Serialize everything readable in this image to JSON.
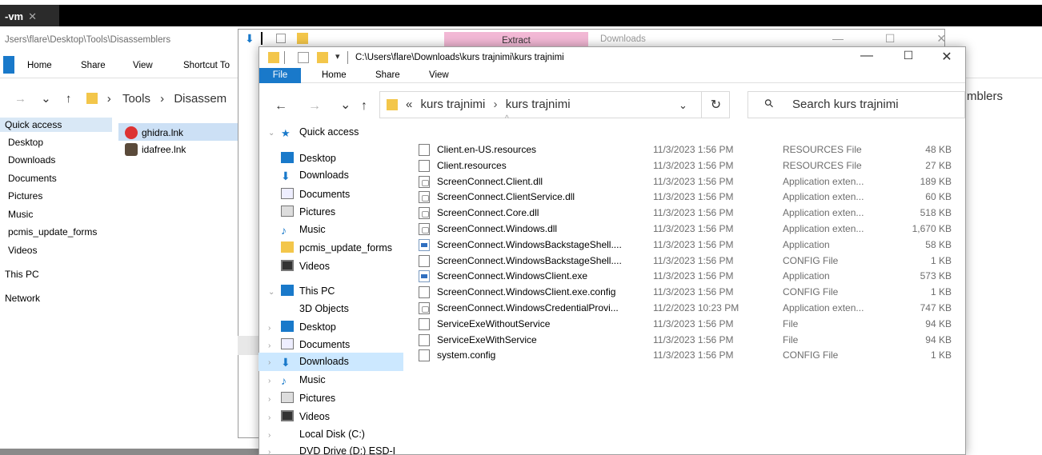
{
  "vm_tab": {
    "label": "-vm",
    "close": "✕"
  },
  "back_window": {
    "path": "Jsers\\flare\\Desktop\\Tools\\Disassemblers",
    "tabs": [
      "Home",
      "Share",
      "View",
      "Shortcut To"
    ],
    "breadcrumb": [
      "Tools",
      "Disassem"
    ],
    "right_crumb": "mblers",
    "sidebar": [
      "Quick access",
      "Desktop",
      "Downloads",
      "Documents",
      "Pictures",
      "Music",
      "pcmis_update_forms",
      "Videos",
      "This PC",
      "Network"
    ],
    "files": [
      "ghidra.lnk",
      "idafree.lnk"
    ]
  },
  "mid_window": {
    "tab_label": "Extract",
    "title": "Downloads"
  },
  "window": {
    "title": "C:\\Users\\flare\\Downloads\\kurs trajnimi\\kurs trajnimi",
    "controls": {
      "minimize": "—",
      "maximize": "☐",
      "close": "✕"
    },
    "ribbon_tabs": {
      "file": "File",
      "home": "Home",
      "share": "Share",
      "view": "View"
    }
  },
  "nav": {
    "back": "←",
    "forward": "→",
    "recent": "⌄",
    "up": "↑",
    "address_prefix": "«",
    "address": [
      "kurs trajnimi",
      "kurs trajnimi"
    ],
    "refresh": "↻",
    "search_placeholder": "Search kurs trajnimi"
  },
  "nav_pane": {
    "quick_access": "Quick access",
    "items": [
      {
        "label": "Desktop",
        "icon": "desktop-icon"
      },
      {
        "label": "Downloads",
        "icon": "downloads-icon"
      },
      {
        "label": "Documents",
        "icon": "documents-icon"
      },
      {
        "label": "Pictures",
        "icon": "pictures-icon"
      },
      {
        "label": "Music",
        "icon": "music-icon"
      },
      {
        "label": "pcmis_update_forms",
        "icon": "folder-icon"
      },
      {
        "label": "Videos",
        "icon": "videos-icon"
      }
    ],
    "this_pc": "This PC",
    "pc_items": [
      {
        "label": "3D Objects",
        "icon": "3d-objects-icon"
      },
      {
        "label": "Desktop",
        "icon": "desktop-icon"
      },
      {
        "label": "Documents",
        "icon": "documents-icon"
      },
      {
        "label": "Downloads",
        "icon": "downloads-icon",
        "selected": true
      },
      {
        "label": "Music",
        "icon": "music-icon"
      },
      {
        "label": "Pictures",
        "icon": "pictures-icon"
      },
      {
        "label": "Videos",
        "icon": "videos-icon"
      },
      {
        "label": "Local Disk (C:)",
        "icon": "disk-icon"
      },
      {
        "label": "DVD Drive (D:) ESD-I",
        "icon": "dvd-icon"
      }
    ]
  },
  "files": [
    {
      "name": "Client.en-US.resources",
      "date": "11/3/2023 1:56 PM",
      "type": "RESOURCES File",
      "size": "48 KB",
      "kind": "file"
    },
    {
      "name": "Client.resources",
      "date": "11/3/2023 1:56 PM",
      "type": "RESOURCES File",
      "size": "27 KB",
      "kind": "file"
    },
    {
      "name": "ScreenConnect.Client.dll",
      "date": "11/3/2023 1:56 PM",
      "type": "Application exten...",
      "size": "189 KB",
      "kind": "dll"
    },
    {
      "name": "ScreenConnect.ClientService.dll",
      "date": "11/3/2023 1:56 PM",
      "type": "Application exten...",
      "size": "60 KB",
      "kind": "dll"
    },
    {
      "name": "ScreenConnect.Core.dll",
      "date": "11/3/2023 1:56 PM",
      "type": "Application exten...",
      "size": "518 KB",
      "kind": "dll"
    },
    {
      "name": "ScreenConnect.Windows.dll",
      "date": "11/3/2023 1:56 PM",
      "type": "Application exten...",
      "size": "1,670 KB",
      "kind": "dll"
    },
    {
      "name": "ScreenConnect.WindowsBackstageShell....",
      "date": "11/3/2023 1:56 PM",
      "type": "Application",
      "size": "58 KB",
      "kind": "exe"
    },
    {
      "name": "ScreenConnect.WindowsBackstageShell....",
      "date": "11/3/2023 1:56 PM",
      "type": "CONFIG File",
      "size": "1 KB",
      "kind": "file"
    },
    {
      "name": "ScreenConnect.WindowsClient.exe",
      "date": "11/3/2023 1:56 PM",
      "type": "Application",
      "size": "573 KB",
      "kind": "exe"
    },
    {
      "name": "ScreenConnect.WindowsClient.exe.config",
      "date": "11/3/2023 1:56 PM",
      "type": "CONFIG File",
      "size": "1 KB",
      "kind": "file"
    },
    {
      "name": "ScreenConnect.WindowsCredentialProvi...",
      "date": "11/2/2023 10:23 PM",
      "type": "Application exten...",
      "size": "747 KB",
      "kind": "dll"
    },
    {
      "name": "ServiceExeWithoutService",
      "date": "11/3/2023 1:56 PM",
      "type": "File",
      "size": "94 KB",
      "kind": "file"
    },
    {
      "name": "ServiceExeWithService",
      "date": "11/3/2023 1:56 PM",
      "type": "File",
      "size": "94 KB",
      "kind": "file"
    },
    {
      "name": "system.config",
      "date": "11/3/2023 1:56 PM",
      "type": "CONFIG File",
      "size": "1 KB",
      "kind": "file"
    }
  ],
  "colors": {
    "accent": "#1979ca",
    "selection": "#cce8ff",
    "folder": "#f3c64a",
    "extract_tab": "#f2b8d5"
  }
}
